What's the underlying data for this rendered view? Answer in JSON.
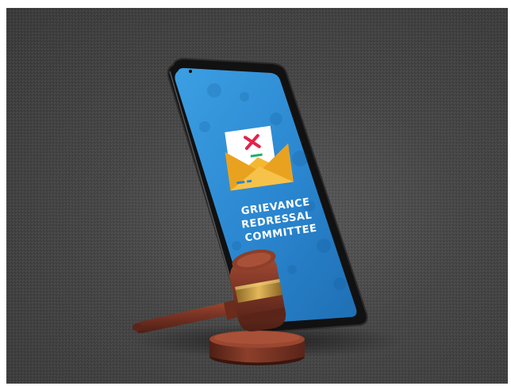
{
  "image": {
    "screen_text_lines": [
      "GRIEVANCE",
      "REDRESSAL",
      "COMMITTEE"
    ],
    "icons": [
      "envelope-icon",
      "x-mark-icon",
      "gavel-icon"
    ],
    "colors": {
      "background": "#474747",
      "screen_blue": "#2f8fd6",
      "envelope_yellow": "#f5b731",
      "x_mark_red": "#e2244a",
      "gavel_wood": "#7a3424",
      "gold_band": "#c99a3a"
    }
  }
}
